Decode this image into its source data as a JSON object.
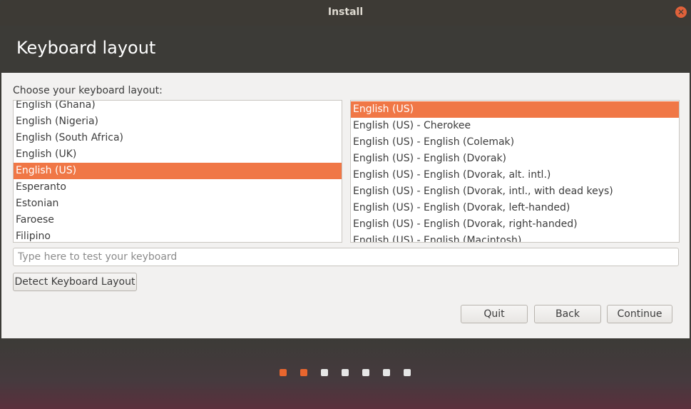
{
  "window": {
    "title": "Install"
  },
  "header": {
    "title": "Keyboard layout"
  },
  "prompt": "Choose your keyboard layout:",
  "layouts": {
    "items": [
      "English (Ghana)",
      "English (Nigeria)",
      "English (South Africa)",
      "English (UK)",
      "English (US)",
      "Esperanto",
      "Estonian",
      "Faroese",
      "Filipino"
    ],
    "selected": "English (US)"
  },
  "variants": {
    "items": [
      "English (US)",
      "English (US) - Cherokee",
      "English (US) - English (Colemak)",
      "English (US) - English (Dvorak)",
      "English (US) - English (Dvorak, alt. intl.)",
      "English (US) - English (Dvorak, intl., with dead keys)",
      "English (US) - English (Dvorak, left-handed)",
      "English (US) - English (Dvorak, right-handed)",
      "English (US) - English (Macintosh)"
    ],
    "selected": "English (US)"
  },
  "test_input": {
    "placeholder": "Type here to test your keyboard",
    "value": ""
  },
  "buttons": {
    "detect": "Detect Keyboard Layout",
    "quit": "Quit",
    "back": "Back",
    "continue": "Continue"
  },
  "progress": {
    "total_steps": 7,
    "current_step": 2
  },
  "colors": {
    "accent": "#f07746",
    "dot_active": "#e9662e",
    "dot_inactive": "#e6e6e6"
  }
}
